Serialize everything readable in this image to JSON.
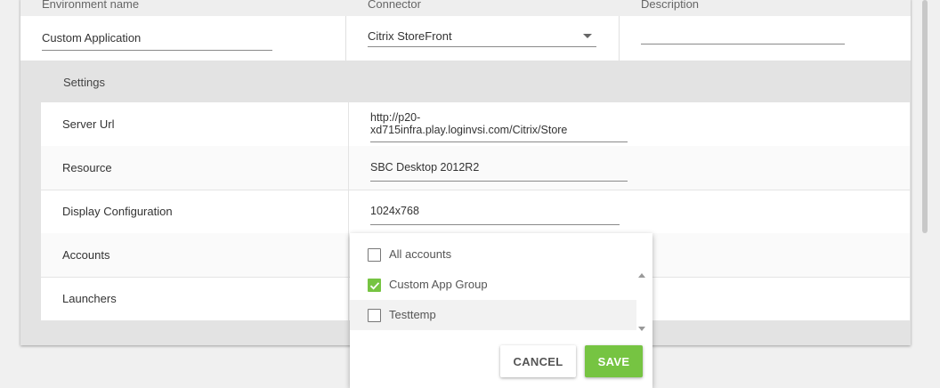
{
  "columns": {
    "environment_name": "Environment name",
    "connector": "Connector",
    "description": "Description"
  },
  "environment": {
    "name": "Custom Application",
    "connector": "Citrix StoreFront",
    "description": ""
  },
  "settings": {
    "title": "Settings",
    "rows": [
      {
        "label": "Server Url",
        "value_line1": "http://p20-",
        "value_line2": "xd715infra.play.loginvsi.com/Citrix/Store"
      },
      {
        "label": "Resource",
        "value": "SBC Desktop 2012R2"
      },
      {
        "label": "Display Configuration",
        "value": "1024x768"
      },
      {
        "label": "Accounts"
      },
      {
        "label": "Launchers"
      }
    ]
  },
  "accounts_popup": {
    "options": [
      {
        "label": "All accounts",
        "checked": false
      },
      {
        "label": "Custom App Group",
        "checked": true
      },
      {
        "label": "Testtemp",
        "checked": false
      }
    ],
    "cancel_label": "CANCEL",
    "save_label": "SAVE"
  },
  "colors": {
    "accent_green": "#76c442",
    "panel_gray": "#e3e3e3"
  }
}
